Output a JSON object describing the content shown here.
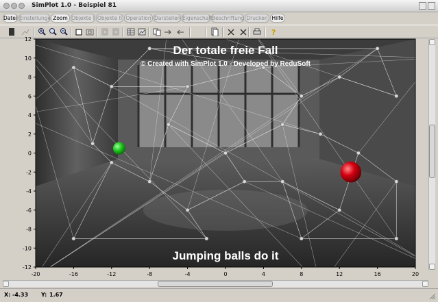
{
  "window": {
    "title": "SimPlot 1.0 - Beispiel 81"
  },
  "menu": [
    {
      "label": "Datei",
      "active": true
    },
    {
      "label": "Einstellungen",
      "active": false
    },
    {
      "label": "Zoom",
      "active": true
    },
    {
      "label": "Objekte I",
      "active": false
    },
    {
      "label": "Objekte II",
      "active": false
    },
    {
      "label": "Operation",
      "active": false
    },
    {
      "label": "Darstellen",
      "active": false
    },
    {
      "label": "Eigenschaft",
      "active": false
    },
    {
      "label": "Beschriftung",
      "active": false
    },
    {
      "label": "Drucken",
      "active": false
    },
    {
      "label": "Hilfe",
      "active": true
    }
  ],
  "toolbar_icons": [
    "file-icon",
    "chart-icon",
    "zoom-in-icon",
    "zoom-icon",
    "zoom-out-icon",
    "square-icon",
    "frame-icon",
    "box-icon",
    "box-icon",
    "table-icon",
    "image-icon",
    "copy-icon",
    "arrow-right-icon",
    "arrow-left-icon",
    "page-icon",
    "cross-icon",
    "cross-icon",
    "print-icon",
    "help-icon"
  ],
  "plot": {
    "title": "Der totale freie Fall",
    "subtitle": "© Created with SimPlot 1.0 - Developed by ReduSoft",
    "caption": "Jumping balls do it",
    "xlim": [
      -20,
      20
    ],
    "ylim": [
      -12,
      12
    ],
    "x_ticks": [
      "-20",
      "-16",
      "-12",
      "-8",
      "-4",
      "0",
      "4",
      "8",
      "12",
      "16",
      "20"
    ],
    "y_ticks": [
      "12",
      "10",
      "8",
      "6",
      "4",
      "2",
      "0",
      "-2",
      "-4",
      "-6",
      "-8",
      "-10",
      "-12"
    ],
    "balls": [
      {
        "name": "green-ball",
        "x": -11.2,
        "y": 0.5,
        "r": 0.65,
        "color": "#1ec81e"
      },
      {
        "name": "red-ball",
        "x": 13.2,
        "y": -2.0,
        "r": 1.1,
        "color": "#d40010"
      }
    ],
    "nodes": [
      [
        -14,
        1
      ],
      [
        -12,
        -1
      ],
      [
        -12,
        7
      ],
      [
        -8,
        11
      ],
      [
        -8,
        -3
      ],
      [
        -6,
        3
      ],
      [
        -4,
        -6
      ],
      [
        -4,
        7
      ],
      [
        -2,
        -9
      ],
      [
        0,
        0
      ],
      [
        2,
        -3
      ],
      [
        4,
        9
      ],
      [
        6,
        -3
      ],
      [
        6,
        3
      ],
      [
        8,
        6
      ],
      [
        8,
        -9
      ],
      [
        10,
        2
      ],
      [
        12,
        8
      ],
      [
        12,
        -6
      ],
      [
        14,
        0
      ],
      [
        18,
        6
      ],
      [
        18,
        -3
      ],
      [
        18,
        -9
      ],
      [
        -16,
        9
      ],
      [
        -16,
        -9
      ],
      [
        16,
        11
      ]
    ],
    "edges": [
      [
        0,
        1
      ],
      [
        0,
        2
      ],
      [
        1,
        4
      ],
      [
        2,
        3
      ],
      [
        2,
        7
      ],
      [
        3,
        11
      ],
      [
        4,
        6
      ],
      [
        4,
        5
      ],
      [
        5,
        7
      ],
      [
        5,
        9
      ],
      [
        6,
        8
      ],
      [
        6,
        10
      ],
      [
        7,
        11
      ],
      [
        9,
        10
      ],
      [
        9,
        13
      ],
      [
        10,
        12
      ],
      [
        12,
        15
      ],
      [
        13,
        14
      ],
      [
        13,
        16
      ],
      [
        11,
        14
      ],
      [
        14,
        17
      ],
      [
        16,
        19
      ],
      [
        17,
        20
      ],
      [
        19,
        21
      ],
      [
        21,
        22
      ],
      [
        18,
        19
      ],
      [
        18,
        15
      ],
      [
        12,
        18
      ],
      [
        0,
        23
      ],
      [
        23,
        2
      ],
      [
        1,
        24
      ],
      [
        24,
        8
      ],
      [
        17,
        25
      ],
      [
        3,
        25
      ],
      [
        20,
        25
      ],
      [
        15,
        22
      ]
    ]
  },
  "statusbar": {
    "x_label": "X:",
    "x_value": "-4.33",
    "y_label": "Y:",
    "y_value": "1.67"
  }
}
